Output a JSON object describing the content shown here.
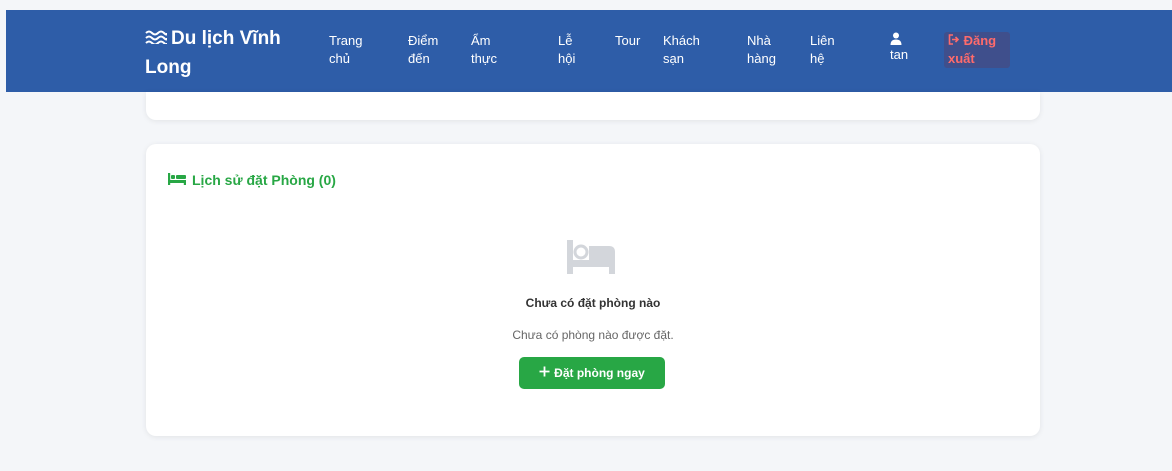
{
  "navbar": {
    "brand": "Du lịch Vĩnh Long",
    "items": [
      {
        "label": "Trang chủ"
      },
      {
        "label": "Điểm đến"
      },
      {
        "label": "Ẩm thực"
      },
      {
        "label": "Lễ hội"
      },
      {
        "label": "Tour"
      },
      {
        "label": "Khách sạn"
      },
      {
        "label": "Nhà hàng"
      },
      {
        "label": "Liên hệ"
      }
    ],
    "user": "tan",
    "logout": "Đăng xuất"
  },
  "booking_history": {
    "title": "Lịch sử đặt Phòng (0)",
    "empty_title": "Chưa có đặt phòng nào",
    "empty_desc": "Chưa có phòng nào được đặt.",
    "book_now": "Đặt phòng ngay"
  },
  "icons": {
    "brand": "water-waves-icon",
    "user": "user-icon",
    "logout": "sign-out-icon",
    "section": "bed-icon",
    "empty": "bed-icon",
    "button": "plus-icon"
  },
  "colors": {
    "navbar": "#2e5da8",
    "accent_green": "#28a745",
    "logout_text": "#ff6b6b",
    "background": "#f4f6f9"
  }
}
